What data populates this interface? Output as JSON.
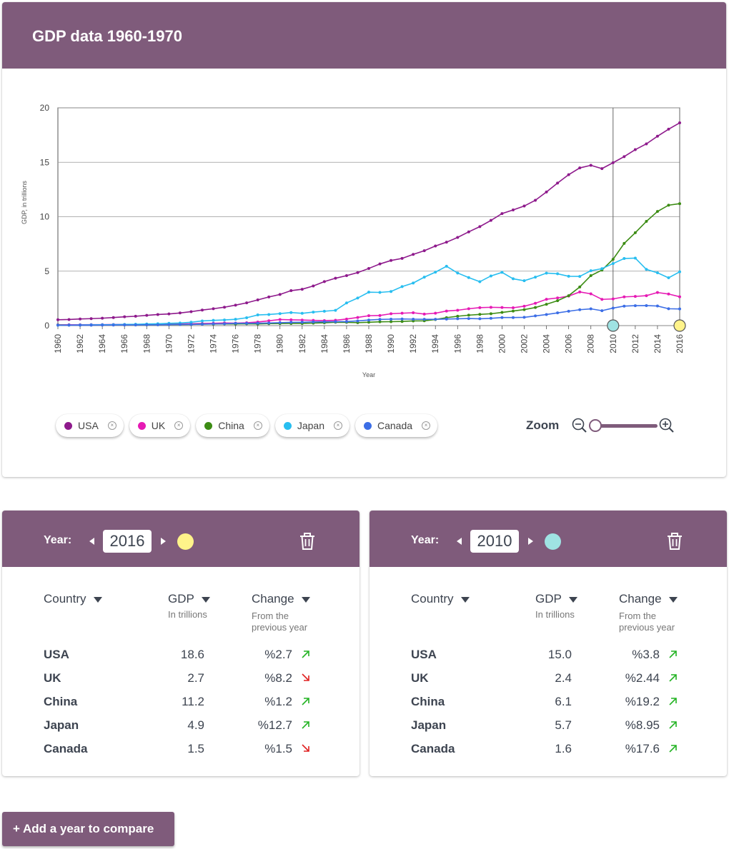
{
  "page_title": "GDP data 1960-1970",
  "chart_data": {
    "type": "line",
    "ylabel": "GDP, in trillions",
    "xlabel": "Year",
    "ylim": [
      0,
      20
    ],
    "xlim": [
      1960,
      2016
    ],
    "y_ticks": [
      0,
      5,
      10,
      15,
      20
    ],
    "x_ticks": [
      1960,
      1962,
      1964,
      1966,
      1968,
      1970,
      1972,
      1974,
      1976,
      1978,
      1980,
      1982,
      1984,
      1986,
      1988,
      1990,
      1992,
      1994,
      1996,
      1998,
      2000,
      2002,
      2004,
      2006,
      2008,
      2010,
      2012,
      2014,
      2016
    ],
    "markers": [
      {
        "year": 2010,
        "color": "#9fe3e3"
      },
      {
        "year": 2016,
        "color": "#fff38a"
      }
    ],
    "x": [
      1960,
      1961,
      1962,
      1963,
      1964,
      1965,
      1966,
      1967,
      1968,
      1969,
      1970,
      1971,
      1972,
      1973,
      1974,
      1975,
      1976,
      1977,
      1978,
      1979,
      1980,
      1981,
      1982,
      1983,
      1984,
      1985,
      1986,
      1987,
      1988,
      1989,
      1990,
      1991,
      1992,
      1993,
      1994,
      1995,
      1996,
      1997,
      1998,
      1999,
      2000,
      2001,
      2002,
      2003,
      2004,
      2005,
      2006,
      2007,
      2008,
      2009,
      2010,
      2011,
      2012,
      2013,
      2014,
      2015,
      2016
    ],
    "series": [
      {
        "name": "USA",
        "color": "#8e1a8c",
        "values": [
          0.54,
          0.56,
          0.61,
          0.64,
          0.68,
          0.74,
          0.81,
          0.86,
          0.94,
          1.02,
          1.07,
          1.16,
          1.28,
          1.43,
          1.55,
          1.69,
          1.88,
          2.09,
          2.36,
          2.63,
          2.86,
          3.21,
          3.34,
          3.64,
          4.04,
          4.35,
          4.59,
          4.87,
          5.25,
          5.66,
          5.98,
          6.17,
          6.54,
          6.88,
          7.31,
          7.66,
          8.1,
          8.61,
          9.09,
          9.66,
          10.29,
          10.62,
          10.98,
          11.51,
          12.27,
          13.09,
          13.86,
          14.48,
          14.72,
          14.42,
          14.96,
          15.52,
          16.16,
          16.69,
          17.39,
          18.04,
          18.62
        ]
      },
      {
        "name": "UK",
        "color": "#e61ab4",
        "values": [
          0.07,
          0.08,
          0.08,
          0.09,
          0.09,
          0.1,
          0.11,
          0.11,
          0.11,
          0.12,
          0.13,
          0.15,
          0.17,
          0.19,
          0.21,
          0.24,
          0.23,
          0.26,
          0.33,
          0.44,
          0.56,
          0.53,
          0.51,
          0.48,
          0.46,
          0.49,
          0.6,
          0.75,
          0.91,
          0.93,
          1.09,
          1.14,
          1.18,
          1.06,
          1.14,
          1.34,
          1.41,
          1.55,
          1.65,
          1.68,
          1.66,
          1.64,
          1.78,
          2.05,
          2.42,
          2.54,
          2.71,
          3.09,
          2.92,
          2.41,
          2.45,
          2.64,
          2.68,
          2.75,
          3.04,
          2.9,
          2.65
        ]
      },
      {
        "name": "China",
        "color": "#3c8c14",
        "values": [
          0.06,
          0.05,
          0.05,
          0.05,
          0.06,
          0.07,
          0.08,
          0.07,
          0.07,
          0.08,
          0.09,
          0.1,
          0.11,
          0.14,
          0.14,
          0.16,
          0.15,
          0.17,
          0.15,
          0.18,
          0.19,
          0.2,
          0.2,
          0.23,
          0.26,
          0.31,
          0.3,
          0.27,
          0.31,
          0.35,
          0.36,
          0.38,
          0.43,
          0.44,
          0.56,
          0.73,
          0.86,
          0.96,
          1.03,
          1.09,
          1.21,
          1.34,
          1.47,
          1.66,
          1.96,
          2.29,
          2.75,
          3.55,
          4.59,
          5.1,
          6.09,
          7.55,
          8.53,
          9.57,
          10.48,
          11.06,
          11.2
        ]
      },
      {
        "name": "Japan",
        "color": "#28bef0",
        "values": [
          0.04,
          0.05,
          0.06,
          0.07,
          0.08,
          0.09,
          0.11,
          0.12,
          0.15,
          0.17,
          0.21,
          0.24,
          0.31,
          0.43,
          0.48,
          0.52,
          0.58,
          0.72,
          0.98,
          1.02,
          1.1,
          1.2,
          1.13,
          1.24,
          1.32,
          1.4,
          2.08,
          2.53,
          3.07,
          3.05,
          3.13,
          3.58,
          3.91,
          4.45,
          4.91,
          5.45,
          4.83,
          4.41,
          4.03,
          4.56,
          4.89,
          4.3,
          4.12,
          4.45,
          4.82,
          4.76,
          4.53,
          4.52,
          5.04,
          5.23,
          5.7,
          6.16,
          6.2,
          5.16,
          4.85,
          4.39,
          4.94
        ]
      },
      {
        "name": "Canada",
        "color": "#3c6ee6",
        "values": [
          0.04,
          0.04,
          0.04,
          0.04,
          0.05,
          0.05,
          0.06,
          0.06,
          0.07,
          0.07,
          0.09,
          0.1,
          0.11,
          0.13,
          0.16,
          0.17,
          0.21,
          0.21,
          0.22,
          0.24,
          0.27,
          0.3,
          0.31,
          0.34,
          0.35,
          0.36,
          0.37,
          0.43,
          0.51,
          0.57,
          0.59,
          0.61,
          0.59,
          0.58,
          0.58,
          0.6,
          0.63,
          0.65,
          0.63,
          0.67,
          0.74,
          0.74,
          0.76,
          0.89,
          1.02,
          1.17,
          1.32,
          1.46,
          1.54,
          1.37,
          1.61,
          1.79,
          1.83,
          1.84,
          1.8,
          1.55,
          1.53
        ]
      }
    ]
  },
  "legend": [
    {
      "label": "USA",
      "color": "#8e1a8c"
    },
    {
      "label": "UK",
      "color": "#e61ab4"
    },
    {
      "label": "China",
      "color": "#3c8c14"
    },
    {
      "label": "Japan",
      "color": "#28bef0"
    },
    {
      "label": "Canada",
      "color": "#3c6ee6"
    }
  ],
  "zoom": {
    "label": "Zoom",
    "level": 0.0
  },
  "year_cards": [
    {
      "year_label": "Year:",
      "year": "2016",
      "marker_color": "#fff38a",
      "headers": {
        "country": "Country",
        "gdp": "GDP",
        "gdp_sub": "In trillions",
        "change": "Change",
        "change_sub": "From the previous year"
      },
      "rows": [
        {
          "country": "USA",
          "gdp": "18.6",
          "change": "%2.7",
          "trend": "up"
        },
        {
          "country": "UK",
          "gdp": "2.7",
          "change": "%8.2",
          "trend": "down"
        },
        {
          "country": "China",
          "gdp": "11.2",
          "change": "%1.2",
          "trend": "up"
        },
        {
          "country": "Japan",
          "gdp": "4.9",
          "change": "%12.7",
          "trend": "up"
        },
        {
          "country": "Canada",
          "gdp": "1.5",
          "change": "%1.5",
          "trend": "down"
        }
      ]
    },
    {
      "year_label": "Year:",
      "year": "2010",
      "marker_color": "#9fe3e3",
      "headers": {
        "country": "Country",
        "gdp": "GDP",
        "gdp_sub": "In trillions",
        "change": "Change",
        "change_sub": "From  the previous year"
      },
      "rows": [
        {
          "country": "USA",
          "gdp": "15.0",
          "change": "%3.8",
          "trend": "up"
        },
        {
          "country": "UK",
          "gdp": "2.4",
          "change": "%2.44",
          "trend": "up"
        },
        {
          "country": "China",
          "gdp": "6.1",
          "change": "%19.2",
          "trend": "up"
        },
        {
          "country": "Japan",
          "gdp": "5.7",
          "change": "%8.95",
          "trend": "up"
        },
        {
          "country": "Canada",
          "gdp": "1.6",
          "change": "%17.6",
          "trend": "up"
        }
      ]
    }
  ],
  "add_button": {
    "label": "+ Add a year to compare"
  },
  "colors": {
    "brand": "#7f5b7b",
    "up": "#22b322",
    "down": "#e02020"
  },
  "icons": {
    "zoom_out": "zoom-out-icon",
    "zoom_in": "zoom-in-icon",
    "trash": "trash-icon",
    "close": "close-circle-icon"
  }
}
